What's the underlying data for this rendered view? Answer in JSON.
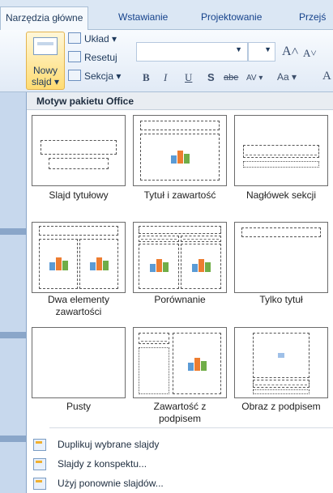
{
  "tabs": [
    "Narzędzia główne",
    "Wstawianie",
    "Projektowanie",
    "Przejś"
  ],
  "ribbon": {
    "new_slide_line1": "Nowy",
    "new_slide_line2": "slajd ▾",
    "layout": "Układ ▾",
    "reset": "Resetuj",
    "section": "Sekcja ▾",
    "bold": "B",
    "italic": "I",
    "underline": "U",
    "shadow": "S",
    "strike": "abe",
    "spacing": "AV ▾",
    "case": "Aa ▾",
    "grow": "A˄",
    "shrink": "A˅"
  },
  "panel": {
    "header": "Motyw pakietu Office",
    "layouts": [
      "Slajd tytułowy",
      "Tytuł i zawartość",
      "Nagłówek sekcji",
      "Dwa elementy zawartości",
      "Porównanie",
      "Tylko tytuł",
      "Pusty",
      "Zawartość z podpisem",
      "Obraz z podpisem"
    ],
    "menu": [
      "Duplikuj wybrane slajdy",
      "Slajdy z konspektu...",
      "Użyj ponownie slajdów..."
    ]
  },
  "colors": {
    "accent_selected": "#ffdc73",
    "ribbon_border": "#a9bfd6"
  },
  "icons": [
    "new-slide-icon",
    "layout-icon",
    "reset-icon",
    "section-icon",
    "content-icon",
    "duplicate-icon",
    "outline-icon",
    "reuse-icon"
  ]
}
